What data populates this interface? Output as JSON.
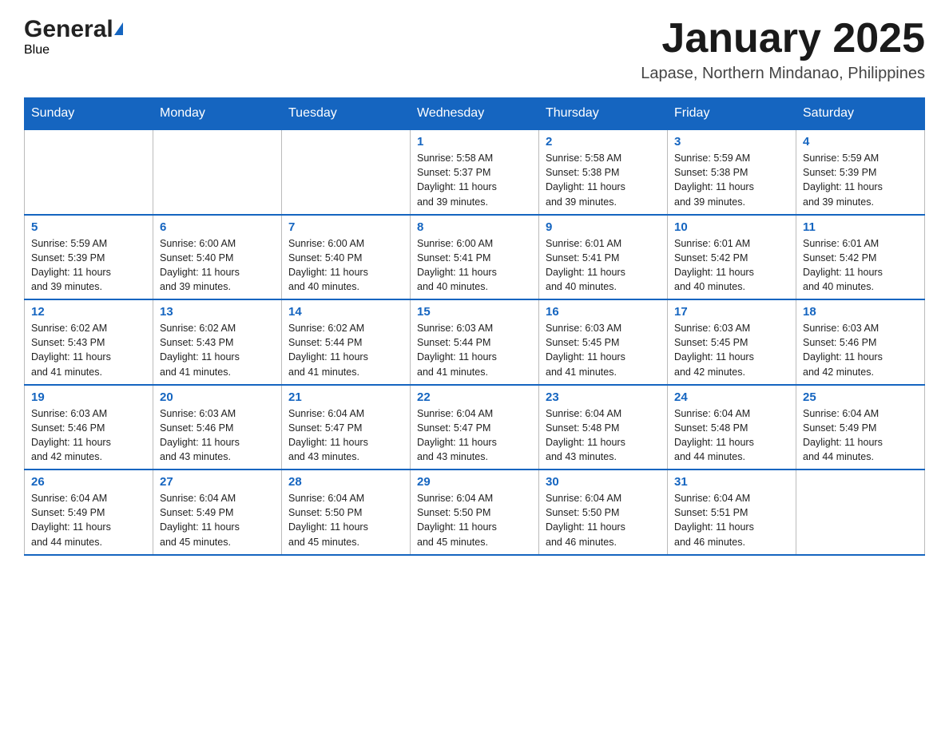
{
  "header": {
    "logo_general": "General",
    "logo_blue": "Blue",
    "month_title": "January 2025",
    "location": "Lapase, Northern Mindanao, Philippines"
  },
  "days_of_week": [
    "Sunday",
    "Monday",
    "Tuesday",
    "Wednesday",
    "Thursday",
    "Friday",
    "Saturday"
  ],
  "weeks": [
    [
      {
        "day": "",
        "info": ""
      },
      {
        "day": "",
        "info": ""
      },
      {
        "day": "",
        "info": ""
      },
      {
        "day": "1",
        "info": "Sunrise: 5:58 AM\nSunset: 5:37 PM\nDaylight: 11 hours\nand 39 minutes."
      },
      {
        "day": "2",
        "info": "Sunrise: 5:58 AM\nSunset: 5:38 PM\nDaylight: 11 hours\nand 39 minutes."
      },
      {
        "day": "3",
        "info": "Sunrise: 5:59 AM\nSunset: 5:38 PM\nDaylight: 11 hours\nand 39 minutes."
      },
      {
        "day": "4",
        "info": "Sunrise: 5:59 AM\nSunset: 5:39 PM\nDaylight: 11 hours\nand 39 minutes."
      }
    ],
    [
      {
        "day": "5",
        "info": "Sunrise: 5:59 AM\nSunset: 5:39 PM\nDaylight: 11 hours\nand 39 minutes."
      },
      {
        "day": "6",
        "info": "Sunrise: 6:00 AM\nSunset: 5:40 PM\nDaylight: 11 hours\nand 39 minutes."
      },
      {
        "day": "7",
        "info": "Sunrise: 6:00 AM\nSunset: 5:40 PM\nDaylight: 11 hours\nand 40 minutes."
      },
      {
        "day": "8",
        "info": "Sunrise: 6:00 AM\nSunset: 5:41 PM\nDaylight: 11 hours\nand 40 minutes."
      },
      {
        "day": "9",
        "info": "Sunrise: 6:01 AM\nSunset: 5:41 PM\nDaylight: 11 hours\nand 40 minutes."
      },
      {
        "day": "10",
        "info": "Sunrise: 6:01 AM\nSunset: 5:42 PM\nDaylight: 11 hours\nand 40 minutes."
      },
      {
        "day": "11",
        "info": "Sunrise: 6:01 AM\nSunset: 5:42 PM\nDaylight: 11 hours\nand 40 minutes."
      }
    ],
    [
      {
        "day": "12",
        "info": "Sunrise: 6:02 AM\nSunset: 5:43 PM\nDaylight: 11 hours\nand 41 minutes."
      },
      {
        "day": "13",
        "info": "Sunrise: 6:02 AM\nSunset: 5:43 PM\nDaylight: 11 hours\nand 41 minutes."
      },
      {
        "day": "14",
        "info": "Sunrise: 6:02 AM\nSunset: 5:44 PM\nDaylight: 11 hours\nand 41 minutes."
      },
      {
        "day": "15",
        "info": "Sunrise: 6:03 AM\nSunset: 5:44 PM\nDaylight: 11 hours\nand 41 minutes."
      },
      {
        "day": "16",
        "info": "Sunrise: 6:03 AM\nSunset: 5:45 PM\nDaylight: 11 hours\nand 41 minutes."
      },
      {
        "day": "17",
        "info": "Sunrise: 6:03 AM\nSunset: 5:45 PM\nDaylight: 11 hours\nand 42 minutes."
      },
      {
        "day": "18",
        "info": "Sunrise: 6:03 AM\nSunset: 5:46 PM\nDaylight: 11 hours\nand 42 minutes."
      }
    ],
    [
      {
        "day": "19",
        "info": "Sunrise: 6:03 AM\nSunset: 5:46 PM\nDaylight: 11 hours\nand 42 minutes."
      },
      {
        "day": "20",
        "info": "Sunrise: 6:03 AM\nSunset: 5:46 PM\nDaylight: 11 hours\nand 43 minutes."
      },
      {
        "day": "21",
        "info": "Sunrise: 6:04 AM\nSunset: 5:47 PM\nDaylight: 11 hours\nand 43 minutes."
      },
      {
        "day": "22",
        "info": "Sunrise: 6:04 AM\nSunset: 5:47 PM\nDaylight: 11 hours\nand 43 minutes."
      },
      {
        "day": "23",
        "info": "Sunrise: 6:04 AM\nSunset: 5:48 PM\nDaylight: 11 hours\nand 43 minutes."
      },
      {
        "day": "24",
        "info": "Sunrise: 6:04 AM\nSunset: 5:48 PM\nDaylight: 11 hours\nand 44 minutes."
      },
      {
        "day": "25",
        "info": "Sunrise: 6:04 AM\nSunset: 5:49 PM\nDaylight: 11 hours\nand 44 minutes."
      }
    ],
    [
      {
        "day": "26",
        "info": "Sunrise: 6:04 AM\nSunset: 5:49 PM\nDaylight: 11 hours\nand 44 minutes."
      },
      {
        "day": "27",
        "info": "Sunrise: 6:04 AM\nSunset: 5:49 PM\nDaylight: 11 hours\nand 45 minutes."
      },
      {
        "day": "28",
        "info": "Sunrise: 6:04 AM\nSunset: 5:50 PM\nDaylight: 11 hours\nand 45 minutes."
      },
      {
        "day": "29",
        "info": "Sunrise: 6:04 AM\nSunset: 5:50 PM\nDaylight: 11 hours\nand 45 minutes."
      },
      {
        "day": "30",
        "info": "Sunrise: 6:04 AM\nSunset: 5:50 PM\nDaylight: 11 hours\nand 46 minutes."
      },
      {
        "day": "31",
        "info": "Sunrise: 6:04 AM\nSunset: 5:51 PM\nDaylight: 11 hours\nand 46 minutes."
      },
      {
        "day": "",
        "info": ""
      }
    ]
  ]
}
